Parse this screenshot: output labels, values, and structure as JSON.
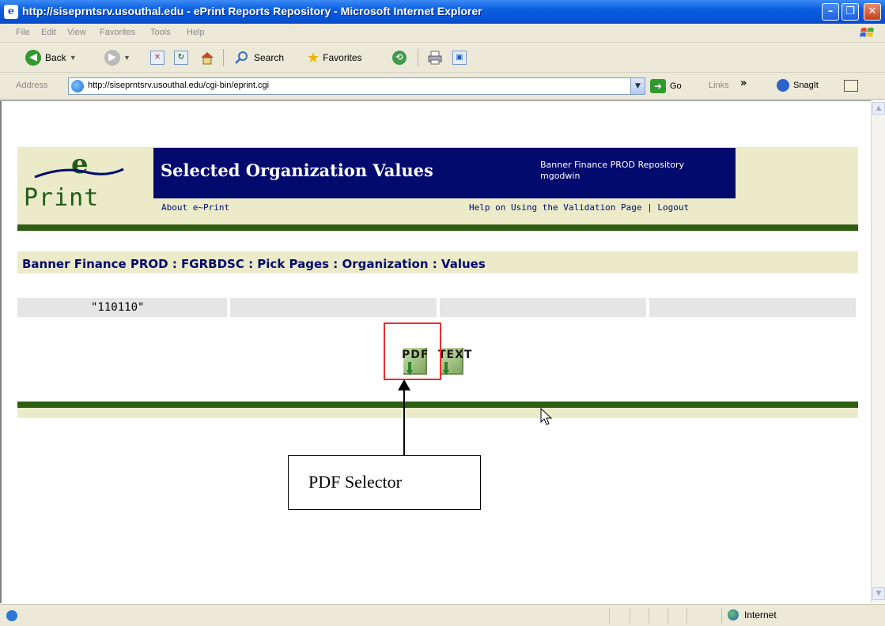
{
  "window": {
    "title": "http://siseprntsrv.usouthal.edu - ePrint Reports Repository - Microsoft Internet Explorer",
    "minimize_glyph": "–",
    "maximize_glyph": "❐",
    "close_glyph": "✕"
  },
  "menu": {
    "items": [
      "File",
      "Edit",
      "View",
      "Favorites",
      "Tools",
      "Help"
    ]
  },
  "toolbar": {
    "back_label": "Back",
    "search_label": "Search",
    "favorites_label": "Favorites"
  },
  "address_bar": {
    "label": "Address",
    "url": "http://siseprntsrv.usouthal.edu/cgi-bin/eprint.cgi",
    "go_label": "Go",
    "links_label": "Links",
    "links_chevron": "»",
    "snagit_label": "SnagIt"
  },
  "eprint": {
    "logo_e": "e",
    "logo_print": "Print",
    "page_title": "Selected Organization Values",
    "repository": "Banner Finance PROD Repository",
    "username": "mgodwin",
    "about_link": "About e~Print",
    "help_link": "Help on Using the Validation Page",
    "link_separator": "|",
    "logout_link": "Logout",
    "breadcrumb": "Banner Finance PROD : FGRBDSC : Pick Pages : Organization : Values",
    "values": [
      "\"110110\"",
      "",
      "",
      ""
    ],
    "pdf_label": "PDF",
    "text_label": "TEXT",
    "accent_green": "#2f5f12",
    "accent_navy": "#020a6e",
    "band_color": "#ecebc9"
  },
  "annotation": {
    "callout_text": "PDF Selector",
    "highlight_color": "#e53030"
  },
  "statusbar": {
    "zone_label": "Internet"
  }
}
